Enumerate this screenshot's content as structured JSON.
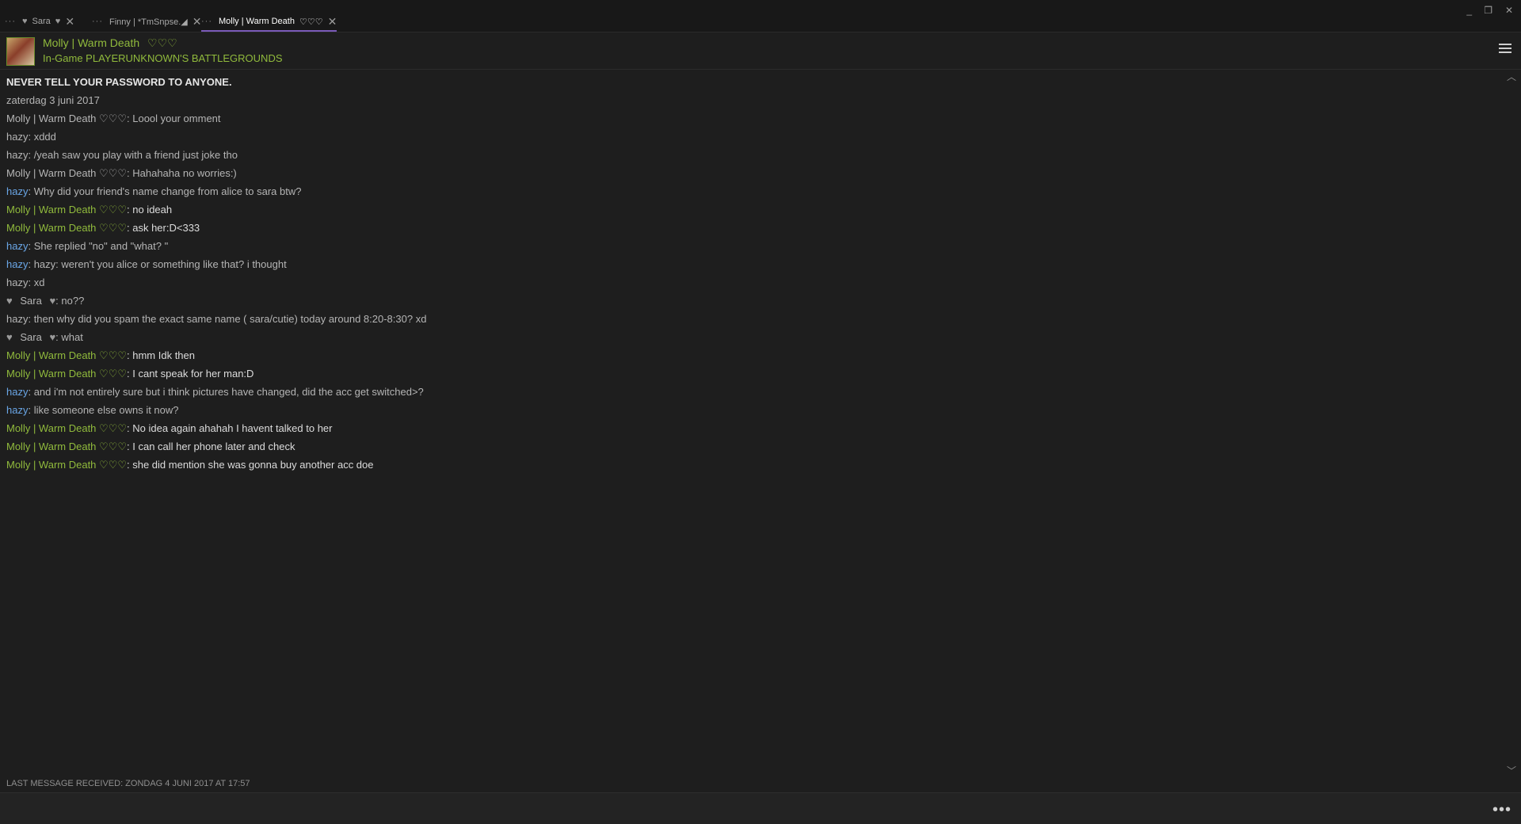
{
  "tabs": [
    {
      "dots": "···",
      "name": "Sara",
      "heart_left": "♥",
      "heart_right": "♥",
      "close": "✕"
    },
    {
      "dots": "···",
      "name": "Finny | *TmSnpse.◢",
      "close": "✕"
    },
    {
      "dots": "···",
      "name": "Molly | Warm Death",
      "hearts": "♡♡♡",
      "close": "✕"
    }
  ],
  "window_controls": {
    "minimize": "_",
    "restore": "❐",
    "close": "✕"
  },
  "header": {
    "name": "Molly | Warm Death",
    "hearts": "♡♡♡",
    "status": "In-Game PLAYERUNKNOWN'S BATTLEGROUNDS"
  },
  "warning": "NEVER TELL YOUR PASSWORD TO ANYONE.",
  "date": "zaterdag 3 juni 2017",
  "hearts3": "♡♡♡",
  "sara_heart": "♥",
  "messages": [
    {
      "author": "Molly | Warm Death",
      "text": ": Loool your  omment"
    },
    {
      "author": "hazy",
      "text": ": xddd"
    },
    {
      "author": "hazy",
      "text": ": /yeah saw you play with a friend just joke tho"
    },
    {
      "author": "Molly | Warm Death",
      "text": ": Hahahaha no worries:)"
    },
    {
      "author": "hazy",
      "text": ": Why did your friend's name change from alice to sara btw?"
    },
    {
      "author": "Molly | Warm Death",
      "text": ": no ideah"
    },
    {
      "author": "Molly | Warm Death",
      "text": ": ask her:D<333"
    },
    {
      "author": "hazy",
      "text": ": She replied \"no\" and \"what? \""
    },
    {
      "author": "hazy",
      "text": ": hazy: weren't you alice or something like that? i thought"
    },
    {
      "author": "hazy",
      "text": ": xd"
    },
    {
      "author": "Sara",
      "text": ": no??"
    },
    {
      "author": "hazy",
      "text": ": then why did you spam the exact same name ( sara/cutie) today around 8:20-8:30? xd"
    },
    {
      "author": "Sara",
      "text": ": what"
    },
    {
      "author": "Molly | Warm Death",
      "text": ": hmm Idk then"
    },
    {
      "author": "Molly | Warm Death",
      "text": ": I cant speak for her man:D"
    },
    {
      "author": "hazy",
      "text": ": and i'm not entirely sure but i think pictures have changed, did the acc get switched>?"
    },
    {
      "author": "hazy",
      "text": ": like someone else owns it now?"
    },
    {
      "author": "Molly | Warm Death",
      "text": ": No idea again ahahah I havent talked to her"
    },
    {
      "author": "Molly | Warm Death",
      "text": ": I can call her phone later and check"
    },
    {
      "author": "Molly | Warm Death",
      "text": ": she did mention she was gonna buy another acc doe"
    }
  ],
  "last_received": "LAST MESSAGE RECEIVED: ZONDAG 4 JUNI 2017 AT 17:57",
  "more": "•••",
  "scroll": {
    "up": "︿",
    "down": "﹀"
  }
}
